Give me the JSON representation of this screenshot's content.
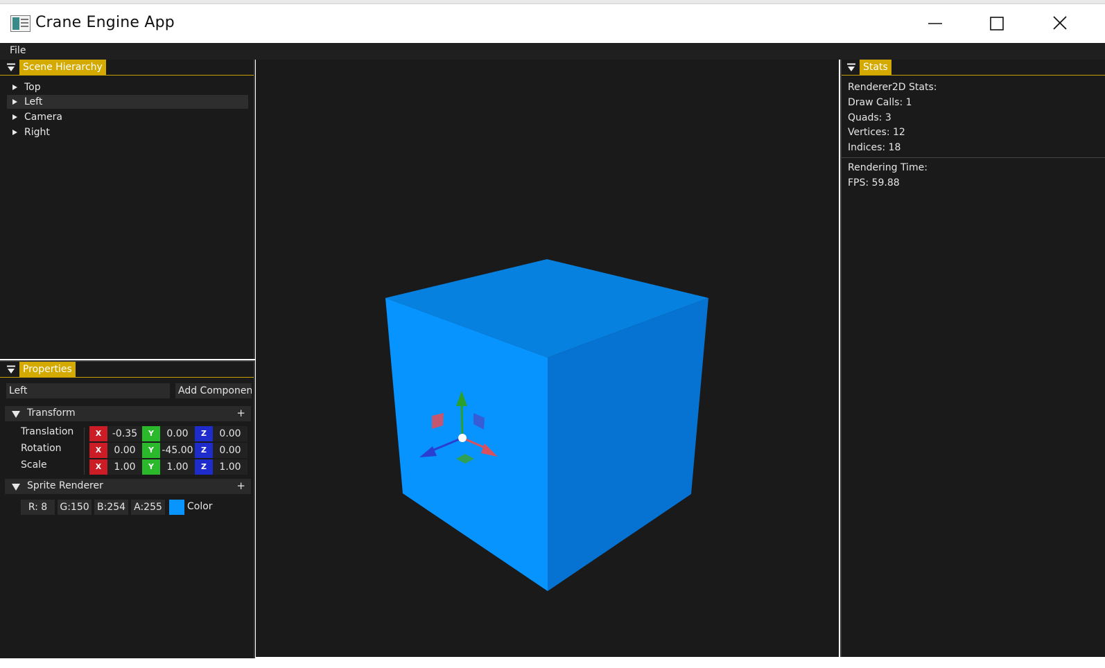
{
  "window": {
    "title": "Crane Engine App",
    "icon": "app-window-icon",
    "minimize_icon": "minimize-icon",
    "maximize_icon": "maximize-icon",
    "close_icon": "close-icon"
  },
  "menu": {
    "file_label": "File"
  },
  "colors": {
    "tab_accent": "#d4aa00",
    "panel_bg": "#1a1a1a",
    "cube_front": "#0894fe",
    "cube_top": "#0781df",
    "cube_right": "#0672d2",
    "axis_x": "#cc1d26",
    "axis_y": "#2ab92a",
    "axis_z": "#1f2ccc"
  },
  "scene_hierarchy": {
    "tab_label": "Scene Hierarchy",
    "items": [
      {
        "label": "Top"
      },
      {
        "label": "Left",
        "selected": true
      },
      {
        "label": "Camera"
      },
      {
        "label": "Right"
      }
    ]
  },
  "properties": {
    "tab_label": "Properties",
    "entity_name": "Left",
    "add_component_label": "Add Componen",
    "transform": {
      "title": "Transform",
      "plus": "+",
      "rows": [
        {
          "label": "Translation",
          "x": "-0.35",
          "y": "0.00",
          "z": "0.00"
        },
        {
          "label": "Rotation",
          "x": "0.00",
          "y": "-45.00",
          "z": "0.00"
        },
        {
          "label": "Scale",
          "x": "1.00",
          "y": "1.00",
          "z": "1.00"
        }
      ],
      "axis_labels": {
        "x": "X",
        "y": "Y",
        "z": "Z"
      }
    },
    "sprite_renderer": {
      "title": "Sprite Renderer",
      "plus": "+",
      "r": "R:  8",
      "g": "G:150",
      "b": "B:254",
      "a": "A:255",
      "color_label": "Color",
      "swatch": "#0896fe"
    }
  },
  "stats": {
    "tab_label": "Stats",
    "renderer_title": "Renderer2D Stats:",
    "draw_calls": "Draw Calls: 1",
    "quads": "Quads: 3",
    "vertices": "Vertices: 12",
    "indices": "Indices: 18",
    "rendering_time": "Rendering Time:",
    "fps": "FPS: 59.88"
  }
}
